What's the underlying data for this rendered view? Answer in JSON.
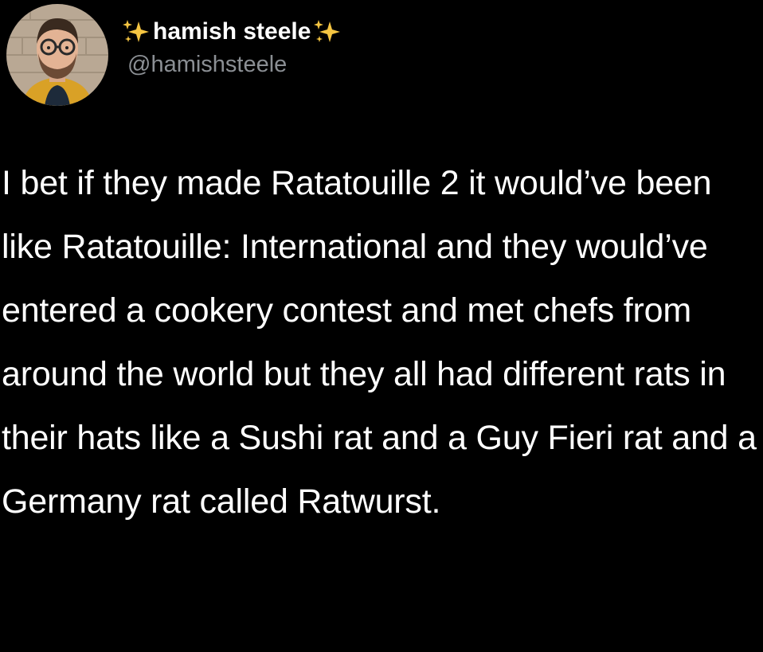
{
  "tweet": {
    "author": {
      "display_name": "hamish steele",
      "handle": "@hamishsteele",
      "decorations": [
        "sparkles-icon",
        "sparkles-icon"
      ],
      "sparkle_color": "#f5c542"
    },
    "text": "I bet if they made Ratatouille 2 it would’ve been like Ratatouille: International and they would’ve entered a cookery contest and met chefs from around the world but they all had different rats in their hats like a Sushi rat and a Guy Fieri rat and a Germany rat called Ratwurst."
  },
  "theme": {
    "background": "#000000",
    "text": "#ffffff",
    "secondary_text": "#8b8f94"
  }
}
